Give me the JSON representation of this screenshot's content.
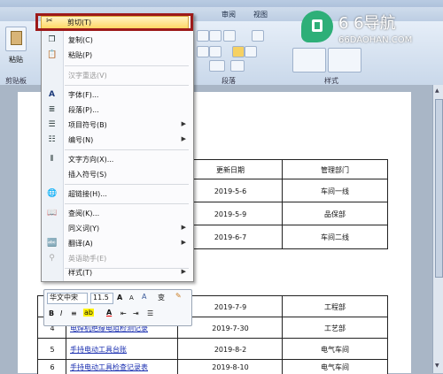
{
  "ribbon": {
    "tabs": [
      "审阅",
      "视图"
    ],
    "paste_label": "粘贴",
    "clipboard_group": "剪贴板",
    "paragraph_group": "段落",
    "styles_group": "样式"
  },
  "watermark": {
    "brand": "6 6导航",
    "domain": "66DAOHAN.COM"
  },
  "menu": {
    "items": [
      {
        "label": "剪切(T)",
        "icon": "scissors-icon",
        "glyph": "✂",
        "disabled": false,
        "submenu": false
      },
      {
        "label": "复制(C)",
        "icon": "copy-icon",
        "glyph": "❐",
        "disabled": false,
        "submenu": false
      },
      {
        "label": "粘贴(P)",
        "icon": "paste-icon",
        "glyph": "📋",
        "disabled": false,
        "submenu": false
      },
      {
        "label": "汉字重选(V)",
        "icon": "",
        "glyph": "",
        "disabled": true,
        "submenu": false
      },
      {
        "label": "字体(F)...",
        "icon": "font-icon",
        "glyph": "A",
        "disabled": false,
        "submenu": false
      },
      {
        "label": "段落(P)...",
        "icon": "paragraph-icon",
        "glyph": "≣",
        "disabled": false,
        "submenu": false
      },
      {
        "label": "项目符号(B)",
        "icon": "bullets-icon",
        "glyph": "☰",
        "disabled": false,
        "submenu": true
      },
      {
        "label": "编号(N)",
        "icon": "numbering-icon",
        "glyph": "☷",
        "disabled": false,
        "submenu": true
      },
      {
        "label": "文字方向(X)...",
        "icon": "text-direction-icon",
        "glyph": "⫴",
        "disabled": false,
        "submenu": false
      },
      {
        "label": "插入符号(S)",
        "icon": "",
        "glyph": "",
        "disabled": false,
        "submenu": false
      },
      {
        "label": "超链接(H)...",
        "icon": "hyperlink-icon",
        "glyph": "🌐",
        "disabled": false,
        "submenu": false
      },
      {
        "label": "查阅(K)...",
        "icon": "lookup-icon",
        "glyph": "📖",
        "disabled": false,
        "submenu": false
      },
      {
        "label": "同义词(Y)",
        "icon": "",
        "glyph": "",
        "disabled": false,
        "submenu": true
      },
      {
        "label": "翻译(A)",
        "icon": "translate-icon",
        "glyph": "🔤",
        "disabled": false,
        "submenu": true
      },
      {
        "label": "英语助手(E)",
        "icon": "english-assistant-icon",
        "glyph": "⚲",
        "disabled": true,
        "submenu": false
      },
      {
        "label": "样式(T)",
        "icon": "",
        "glyph": "",
        "disabled": false,
        "submenu": true
      }
    ]
  },
  "mini_toolbar": {
    "font": "华文中宋",
    "size": "11.5",
    "grow": "A",
    "shrink": "A",
    "bold": "B",
    "italic": "I",
    "font_color": "A"
  },
  "table": {
    "header": {
      "date": "更新日期",
      "dept": "管理部门"
    },
    "rows_top": [
      {
        "date": "2019-5-6",
        "dept": "车间一线"
      },
      {
        "date": "2019-5-9",
        "dept": "品保部"
      },
      {
        "date": "2019-6-7",
        "dept": "车间二线"
      }
    ],
    "rows_bottom": [
      {
        "num": "",
        "name": "",
        "date": "2019-7-9",
        "dept": "工程部"
      },
      {
        "num": "4",
        "name": "电焊机绝缘电阻检测记录",
        "date": "2019-7-30",
        "dept": "工艺部"
      },
      {
        "num": "5",
        "name": "手持电动工具台账",
        "date": "2019-8-2",
        "dept": "电气车间"
      },
      {
        "num": "6",
        "name": "手持电动工具检查记录表",
        "date": "2019-8-10",
        "dept": "电气车间"
      }
    ]
  }
}
